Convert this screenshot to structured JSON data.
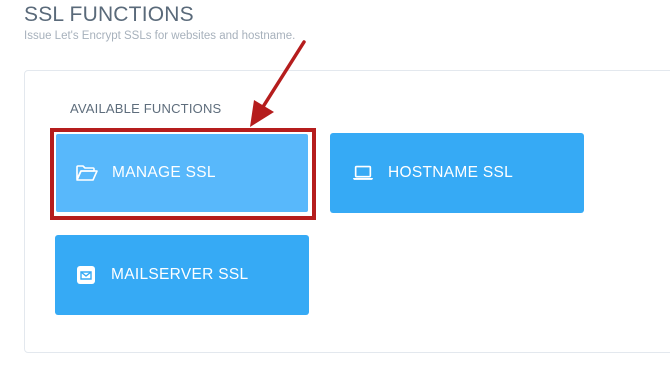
{
  "header": {
    "title": "SSL FUNCTIONS",
    "subtitle": "Issue Let's Encrypt SSLs for websites and hostname."
  },
  "panel": {
    "section_label": "AVAILABLE FUNCTIONS",
    "functions": [
      {
        "label": "MANAGE SSL",
        "icon": "folder-open-icon",
        "highlighted": true
      },
      {
        "label": "HOSTNAME SSL",
        "icon": "laptop-icon",
        "highlighted": false
      },
      {
        "label": "MAILSERVER SSL",
        "icon": "envelope-icon",
        "highlighted": false
      }
    ]
  },
  "colors": {
    "button": "#36aaf5",
    "button_hover": "#58b8fb",
    "highlight": "#b51d1d",
    "title": "#5a6a7a"
  }
}
